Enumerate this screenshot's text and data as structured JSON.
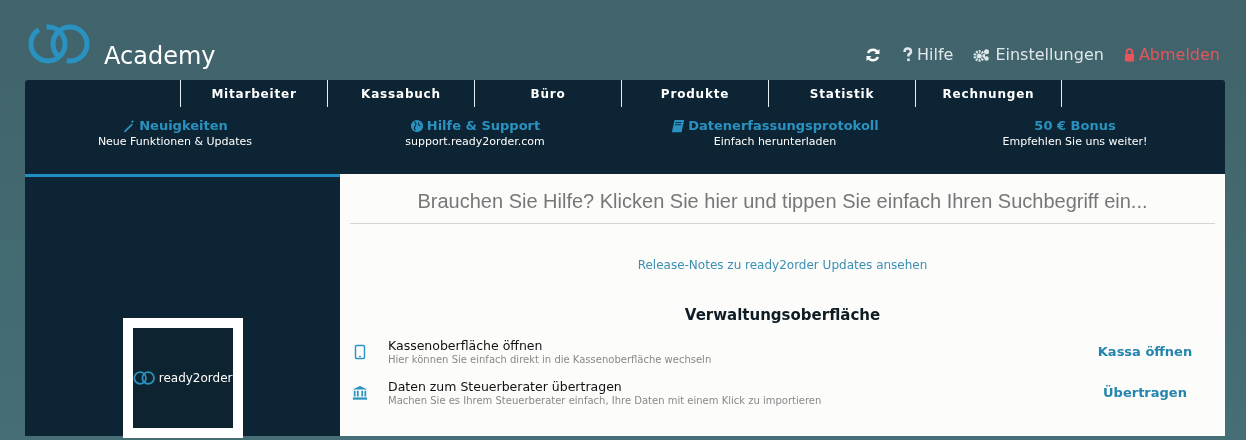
{
  "header": {
    "brand": "Academy",
    "actions": [
      {
        "kind": "refresh"
      },
      {
        "kind": "help",
        "label": "Hilfe"
      },
      {
        "kind": "settings",
        "label": "Einstellungen"
      },
      {
        "kind": "logout",
        "label": "Abmelden"
      }
    ]
  },
  "tabs": [
    {
      "label": "Mitarbeiter",
      "selected": false
    },
    {
      "label": "Kassabuch",
      "selected": false
    },
    {
      "label": "Büro",
      "selected": false
    },
    {
      "label": "Produkte",
      "selected": false
    },
    {
      "label": "Statistik",
      "selected": false
    },
    {
      "label": "Rechnungen",
      "selected": false
    }
  ],
  "features": [
    {
      "kind": "news",
      "title": "Neuigkeiten",
      "subtitle": "Neue Funktionen & Updates"
    },
    {
      "kind": "support",
      "title": "Hilfe & Support",
      "subtitle": "support.ready2order.com"
    },
    {
      "kind": "protocol",
      "title": "Datenerfassungsprotokoll",
      "subtitle": "Einfach herunterladen"
    },
    {
      "kind": "bonus",
      "title": "50 € Bonus",
      "subtitle": "Empfehlen Sie uns weiter!"
    }
  ],
  "sidebar": {
    "logo_text": "ready2order"
  },
  "search": {
    "placeholder": "Brauchen Sie Hilfe? Klicken Sie hier und tippen Sie einfach Ihren Suchbegriff ein..."
  },
  "release_notes_link": "Release-Notes zu ready2order Updates ansehen",
  "section_title": "Verwaltungsoberfläche",
  "items": [
    {
      "kind": "pos",
      "title": "Kassenoberfläche öffnen",
      "description": "Hier können Sie einfach direkt in die Kassenoberfläche wechseln",
      "action": "Kassa öffnen"
    },
    {
      "kind": "tax",
      "title": "Daten zum Steuerberater übertragen",
      "description": "Machen Sie es Ihrem Steuerberater einfach, Ihre Daten mit einem Klick zu importieren",
      "action": "Übertragen"
    }
  ]
}
